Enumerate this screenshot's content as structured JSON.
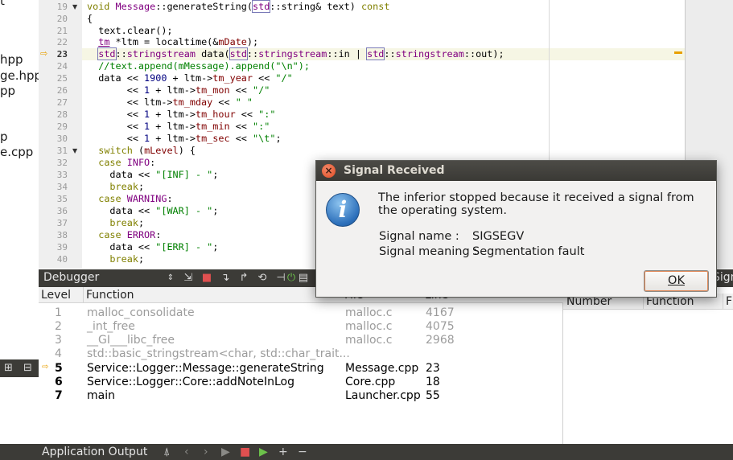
{
  "left_panel": {
    "items": [
      "t",
      "hpp",
      "ge.hpp",
      "pp",
      "p",
      "e.cpp"
    ]
  },
  "editor": {
    "current_line": "23",
    "lines": [
      {
        "n": "19",
        "fold": true
      },
      {
        "n": "20"
      },
      {
        "n": "21"
      },
      {
        "n": "22"
      },
      {
        "n": "23"
      },
      {
        "n": "24"
      },
      {
        "n": "25"
      },
      {
        "n": "26"
      },
      {
        "n": "27"
      },
      {
        "n": "28"
      },
      {
        "n": "29"
      },
      {
        "n": "30"
      },
      {
        "n": "31",
        "fold": true
      },
      {
        "n": "32"
      },
      {
        "n": "33"
      },
      {
        "n": "34"
      },
      {
        "n": "35"
      },
      {
        "n": "36"
      },
      {
        "n": "37"
      },
      {
        "n": "38"
      },
      {
        "n": "39"
      },
      {
        "n": "40"
      }
    ],
    "code": {
      "l19_a": "void ",
      "l19_b": "Message",
      "l19_c": "::generateString(",
      "l19_d": "std",
      "l19_e": "::string& text) ",
      "l19_f": "const",
      "l20": "{",
      "l21": "  text.clear();",
      "l22_a": "  ",
      "l22_b": "tm",
      "l22_c": " *ltm = localtime(&",
      "l22_d": "mDate",
      "l22_e": ");",
      "l23_a": "  ",
      "l23_b": "std",
      "l23_c": "::",
      "l23_d": "stringstream",
      "l23_e": " data(",
      "l23_f": "std",
      "l23_g": "::",
      "l23_h": "stringstream",
      "l23_i": "::in | ",
      "l23_j": "std",
      "l23_k": "::",
      "l23_l": "stringstream",
      "l23_m": "::out);",
      "l24": "  //text.append(mMessage).append(\"\\n\");",
      "l25_a": "  data << ",
      "l25_b": "1900",
      "l25_c": " + ltm->",
      "l25_d": "tm_year",
      "l25_e": " << ",
      "l25_f": "\"/\"",
      "l26_a": "       << ",
      "l26_b": "1",
      "l26_c": " + ltm->",
      "l26_d": "tm_mon",
      "l26_e": " << ",
      "l26_f": "\"/\"",
      "l27_a": "       << ltm->",
      "l27_b": "tm_mday",
      "l27_c": " << ",
      "l27_d": "\" \"",
      "l28_a": "       << ",
      "l28_b": "1",
      "l28_c": " + ltm->",
      "l28_d": "tm_hour",
      "l28_e": " << ",
      "l28_f": "\":\"",
      "l29_a": "       << ",
      "l29_b": "1",
      "l29_c": " + ltm->",
      "l29_d": "tm_min",
      "l29_e": " << ",
      "l29_f": "\":\"",
      "l30_a": "       << ",
      "l30_b": "1",
      "l30_c": " + ltm->",
      "l30_d": "tm_sec",
      "l30_e": " << ",
      "l30_f": "\"\\t\"",
      "l30_g": ";",
      "l31_a": "  ",
      "l31_b": "switch",
      "l31_c": " (",
      "l31_d": "mLevel",
      "l31_e": ") {",
      "l32_a": "  ",
      "l32_b": "case",
      "l32_c": " ",
      "l32_d": "INFO",
      "l32_e": ":",
      "l33_a": "    data << ",
      "l33_b": "\"[INF] - \"",
      "l33_c": ";",
      "l34_a": "    ",
      "l34_b": "break",
      "l34_c": ";",
      "l35_a": "  ",
      "l35_b": "case",
      "l35_c": " ",
      "l35_d": "WARNING",
      "l35_e": ":",
      "l36_a": "    data << ",
      "l36_b": "\"[WAR] - \"",
      "l36_c": ";",
      "l37_a": "    ",
      "l37_b": "break",
      "l37_c": ";",
      "l38_a": "  ",
      "l38_b": "case",
      "l38_c": " ",
      "l38_d": "ERROR",
      "l38_e": ":",
      "l39_a": "    data << ",
      "l39_b": "\"[ERR] - \"",
      "l39_c": ";",
      "l40_a": "    ",
      "l40_b": "break",
      "l40_c": ";"
    }
  },
  "debugger": {
    "title": "Debugger",
    "columns": {
      "level": "Level",
      "function": "Function",
      "file": "File",
      "line": "Line"
    },
    "rows": [
      {
        "level": "1",
        "function": "malloc_consolidate",
        "file": "malloc.c",
        "line": "4167",
        "active": false
      },
      {
        "level": "2",
        "function": "_int_free",
        "file": "malloc.c",
        "line": "4075",
        "active": false
      },
      {
        "level": "3",
        "function": "__GI___libc_free",
        "file": "malloc.c",
        "line": "2968",
        "active": false
      },
      {
        "level": "4",
        "function": "std::basic_stringstream<char, std::char_trait...",
        "file": "",
        "line": "",
        "active": false
      },
      {
        "level": "5",
        "function": "Service::Logger::Message::generateString",
        "file": "Message.cpp",
        "line": "23",
        "active": true,
        "current": true
      },
      {
        "level": "6",
        "function": "Service::Logger::Core::addNoteInLog",
        "file": "Core.cpp",
        "line": "18",
        "active": true
      },
      {
        "level": "7",
        "function": "main",
        "file": "Launcher.cpp",
        "line": "55",
        "active": true
      }
    ]
  },
  "threads": {
    "title": "Signa",
    "columns": {
      "number": "Number",
      "function": "Function",
      "f": "F"
    }
  },
  "app_output": {
    "title": "Application Output"
  },
  "dialog": {
    "title": "Signal Received",
    "message": "The inferior stopped because it received a signal from the operating system.",
    "name_label": "Signal name :",
    "name_value": "SIGSEGV",
    "meaning_label": "Signal meaning :",
    "meaning_value": "Segmentation fault",
    "ok_label": "OK"
  },
  "colors": {
    "accent_marker": "#e8a000",
    "dark_bar": "#3c3b37",
    "close_button": "#df4a22",
    "info_icon": "#2c6fba"
  }
}
